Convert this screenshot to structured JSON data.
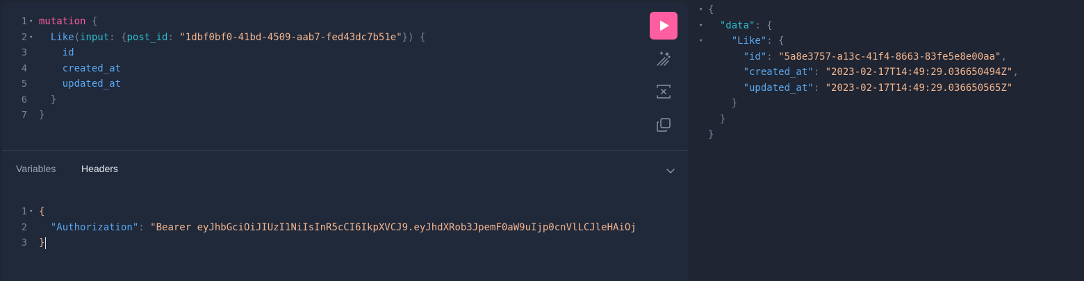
{
  "editor": {
    "lines": [
      {
        "num": "1",
        "fold": "▾",
        "tokens": [
          {
            "t": "mutation",
            "c": "kw"
          },
          {
            "t": " {",
            "c": "punct"
          }
        ]
      },
      {
        "num": "2",
        "fold": "▾",
        "tokens": [
          {
            "t": "  Like",
            "c": "field"
          },
          {
            "t": "(",
            "c": "punct"
          },
          {
            "t": "input",
            "c": "arg"
          },
          {
            "t": ": {",
            "c": "punct"
          },
          {
            "t": "post_id",
            "c": "arg"
          },
          {
            "t": ": ",
            "c": "punct"
          },
          {
            "t": "\"1dbf0bf0-41bd-4509-aab7-fed43dc7b51e\"",
            "c": "str"
          },
          {
            "t": "}) {",
            "c": "punct"
          }
        ]
      },
      {
        "num": "3",
        "fold": "",
        "tokens": [
          {
            "t": "    id",
            "c": "field"
          }
        ]
      },
      {
        "num": "4",
        "fold": "",
        "tokens": [
          {
            "t": "    created_at",
            "c": "field"
          }
        ]
      },
      {
        "num": "5",
        "fold": "",
        "tokens": [
          {
            "t": "    updated_at",
            "c": "field"
          }
        ]
      },
      {
        "num": "6",
        "fold": "",
        "tokens": [
          {
            "t": "  }",
            "c": "punct"
          }
        ]
      },
      {
        "num": "7",
        "fold": "",
        "tokens": [
          {
            "t": "}",
            "c": "punct"
          }
        ]
      }
    ]
  },
  "toolbar": {
    "run_icon": "play-icon",
    "prettify_icon": "magic-wand-icon",
    "merge_icon": "merge-fragments-icon",
    "copy_icon": "copy-icon"
  },
  "tabs": {
    "variables": "Variables",
    "headers": "Headers",
    "toggle_icon": "chevron-down-icon"
  },
  "headers_editor": {
    "lines": [
      {
        "num": "1",
        "fold": "▾",
        "tokens": [
          {
            "t": "{",
            "c": "str"
          }
        ]
      },
      {
        "num": "2",
        "fold": "",
        "tokens": [
          {
            "t": "  \"Authorization\"",
            "c": "prop"
          },
          {
            "t": ": ",
            "c": "punct"
          },
          {
            "t": "\"Bearer eyJhbGciOiJIUzI1NiIsInR5cCI6IkpXVCJ9.eyJhdXRob3JpemF0aW9uIjp0cnVlLCJleHAiOj",
            "c": "str"
          }
        ]
      },
      {
        "num": "3",
        "fold": "",
        "tokens": [
          {
            "t": "}",
            "c": "str"
          }
        ],
        "cursor": true
      }
    ]
  },
  "response": {
    "lines": [
      {
        "fold": "▾",
        "tokens": [
          {
            "t": "{",
            "c": "punct"
          }
        ]
      },
      {
        "fold": "▾",
        "tokens": [
          {
            "t": "  ",
            "c": "punct"
          },
          {
            "t": "\"data\"",
            "c": "arg"
          },
          {
            "t": ": {",
            "c": "punct"
          }
        ]
      },
      {
        "fold": "▾",
        "tokens": [
          {
            "t": "    ",
            "c": "punct"
          },
          {
            "t": "\"Like\"",
            "c": "prop"
          },
          {
            "t": ": {",
            "c": "punct"
          }
        ]
      },
      {
        "fold": "",
        "tokens": [
          {
            "t": "      ",
            "c": "punct"
          },
          {
            "t": "\"id\"",
            "c": "prop"
          },
          {
            "t": ": ",
            "c": "punct"
          },
          {
            "t": "\"5a8e3757-a13c-41f4-8663-83fe5e8e00aa\"",
            "c": "str"
          },
          {
            "t": ",",
            "c": "punct"
          }
        ]
      },
      {
        "fold": "",
        "tokens": [
          {
            "t": "      ",
            "c": "punct"
          },
          {
            "t": "\"created_at\"",
            "c": "prop"
          },
          {
            "t": ": ",
            "c": "punct"
          },
          {
            "t": "\"2023-02-17T14:49:29.036650494Z\"",
            "c": "str"
          },
          {
            "t": ",",
            "c": "punct"
          }
        ]
      },
      {
        "fold": "",
        "tokens": [
          {
            "t": "      ",
            "c": "punct"
          },
          {
            "t": "\"updated_at\"",
            "c": "prop"
          },
          {
            "t": ": ",
            "c": "punct"
          },
          {
            "t": "\"2023-02-17T14:49:29.036650565Z\"",
            "c": "str"
          }
        ]
      },
      {
        "fold": "",
        "tokens": [
          {
            "t": "    }",
            "c": "punct"
          }
        ]
      },
      {
        "fold": "",
        "tokens": [
          {
            "t": "  }",
            "c": "punct"
          }
        ]
      },
      {
        "fold": "",
        "tokens": [
          {
            "t": "}",
            "c": "punct"
          }
        ]
      }
    ]
  },
  "colors": {
    "accent": "#ff5fa0",
    "background": "#1f2532",
    "editor_background": "#20293a"
  }
}
